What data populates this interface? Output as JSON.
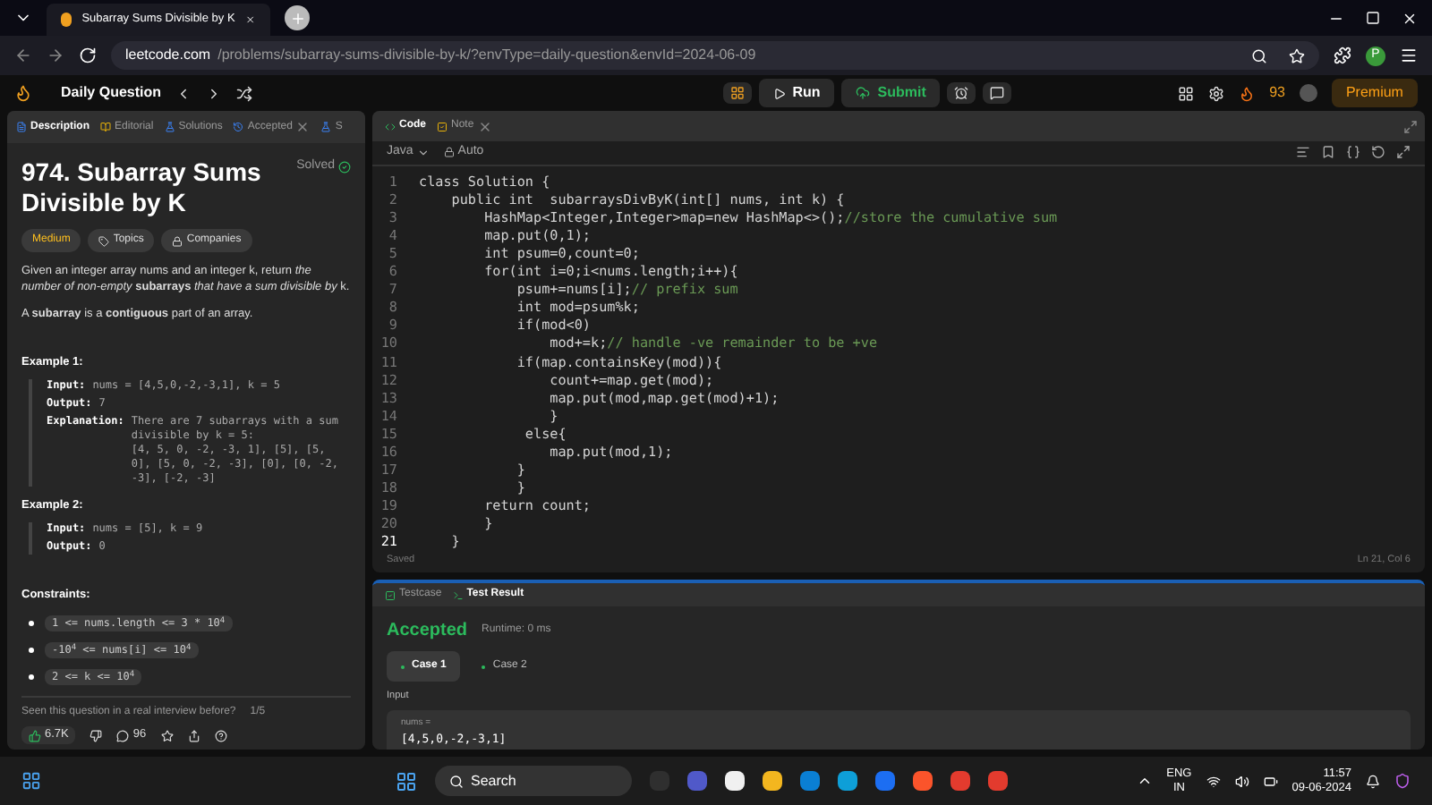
{
  "browser": {
    "tab_title": "Subarray Sums Divisible by K",
    "url_domain": "leetcode.com",
    "url_path": "/problems/subarray-sums-divisible-by-k/?envType=daily-question&envId=2024-06-09",
    "profile_initial": "P"
  },
  "nav": {
    "title": "Daily Question",
    "run": "Run",
    "submit": "Submit",
    "streak": "93",
    "premium": "Premium"
  },
  "left_tabs": [
    {
      "label": "Description",
      "selected": true,
      "closable": false
    },
    {
      "label": "Editorial",
      "selected": false,
      "closable": false
    },
    {
      "label": "Solutions",
      "selected": false,
      "closable": false
    },
    {
      "label": "Accepted",
      "selected": false,
      "closable": true
    },
    {
      "label": "S",
      "selected": false,
      "closable": false
    }
  ],
  "problem": {
    "title": "974. Subarray Sums Divisible by K",
    "status": "Solved",
    "difficulty": "Medium",
    "tags": [
      "Topics",
      "Companies"
    ],
    "paragraphs": [
      "Given an integer array nums and an integer k, return *the number of non-empty* **subarrays** *that have a sum divisible by* k.",
      "A **subarray** is a **contiguous** part of an array."
    ],
    "examples": [
      {
        "heading": "Example 1:",
        "lines": [
          {
            "label": "Input:",
            "text": "nums = [4,5,0,-2,-3,1], k = 5"
          },
          {
            "label": "Output:",
            "text": "7"
          },
          {
            "label": "Explanation:",
            "text": "There are 7 subarrays with a sum divisible by k = 5:\n[4, 5, 0, -2, -3, 1], [5], [5, 0], [5, 0, -2, -3], [0], [0, -2, -3], [-2, -3]"
          }
        ]
      },
      {
        "heading": "Example 2:",
        "lines": [
          {
            "label": "Input:",
            "text": "nums = [5], k = 9"
          },
          {
            "label": "Output:",
            "text": "0"
          }
        ]
      }
    ],
    "constraints_heading": "Constraints:",
    "constraints": [
      "1 <= nums.length <= 3 * 10$^{4}$",
      "-10$^{4}$ <= nums[i] <= 10$^{4}$",
      "2 <= k <= 10$^{4}$"
    ],
    "footer_question": "Seen this question in a real interview before?",
    "footer_page": "1/5",
    "likes": "6.7K",
    "comments": "96"
  },
  "editor": {
    "tabs": [
      {
        "label": "Code",
        "selected": true,
        "closable": false
      },
      {
        "label": "Note",
        "selected": false,
        "closable": true
      }
    ],
    "language": "Java",
    "mode": "Auto",
    "lines": [
      {
        "n": "1",
        "code": "class Solution {"
      },
      {
        "n": "2",
        "code": "    public int  subarraysDivByK(int[] nums, int k) {"
      },
      {
        "n": "3",
        "code": "        HashMap<Integer,Integer>map=new HashMap<>();",
        "comment": "//store the cumulative sum"
      },
      {
        "n": "4",
        "code": "        map.put(0,1);"
      },
      {
        "n": "5",
        "code": "        int psum=0,count=0;"
      },
      {
        "n": "6",
        "code": "        for(int i=0;i<nums.length;i++){"
      },
      {
        "n": "7",
        "code": "            psum+=nums[i];",
        "comment": "// prefix sum"
      },
      {
        "n": "8",
        "code": "            int mod=psum%k;"
      },
      {
        "n": "9",
        "code": "            if(mod<0)"
      },
      {
        "n": "10",
        "code": "                mod+=k;",
        "comment": "// handle -ve remainder to be +ve"
      },
      {
        "n": "11",
        "code": "            if(map.containsKey(mod)){"
      },
      {
        "n": "12",
        "code": "                count+=map.get(mod);"
      },
      {
        "n": "13",
        "code": "                map.put(mod,map.get(mod)+1);"
      },
      {
        "n": "14",
        "code": "                }"
      },
      {
        "n": "15",
        "code": "             else{"
      },
      {
        "n": "16",
        "code": "                map.put(mod,1);"
      },
      {
        "n": "17",
        "code": "            }"
      },
      {
        "n": "18",
        "code": "            }"
      },
      {
        "n": "19",
        "code": "        return count;"
      },
      {
        "n": "20",
        "code": "        }"
      },
      {
        "n": "21",
        "code": "    }",
        "current": true
      }
    ],
    "saved": "Saved",
    "cursor": "Ln 21, Col 6"
  },
  "result": {
    "tabs": [
      {
        "label": "Testcase",
        "selected": false
      },
      {
        "label": "Test Result",
        "selected": true
      }
    ],
    "verdict": "Accepted",
    "runtime": "Runtime: 0 ms",
    "cases": [
      {
        "label": "Case 1",
        "selected": true
      },
      {
        "label": "Case 2",
        "selected": false
      }
    ],
    "input_heading": "Input",
    "param": "nums =",
    "value": "[4,5,0,-2,-3,1]"
  },
  "taskbar": {
    "search": "Search",
    "lang": "ENG",
    "region": "IN",
    "time": "11:57",
    "date": "09-06-2024"
  }
}
